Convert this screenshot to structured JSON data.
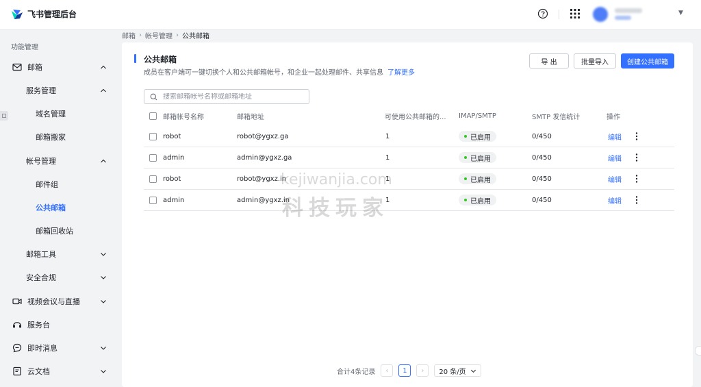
{
  "header": {
    "app_title": "飞书管理后台"
  },
  "sidebar": {
    "section_label": "功能管理",
    "items": [
      {
        "label": "邮箱"
      },
      {
        "label": "服务管理"
      },
      {
        "label": "域名管理"
      },
      {
        "label": "邮箱搬家"
      },
      {
        "label": "帐号管理"
      },
      {
        "label": "邮件组"
      },
      {
        "label": "公共邮箱"
      },
      {
        "label": "邮箱回收站"
      },
      {
        "label": "邮箱工具"
      },
      {
        "label": "安全合规"
      },
      {
        "label": "视频会议与直播"
      },
      {
        "label": "服务台"
      },
      {
        "label": "即时消息"
      },
      {
        "label": "云文档"
      }
    ]
  },
  "breadcrumb": {
    "items": [
      "邮箱",
      "帐号管理",
      "公共邮箱"
    ]
  },
  "page": {
    "title": "公共邮箱",
    "description": "成员在客户端可一键切换个人和公共邮箱帐号，和企业一起处理邮件、共享信息",
    "learn_more": "了解更多",
    "buttons": {
      "export": "导 出",
      "batch_import": "批量导入",
      "create": "创建公共邮箱"
    }
  },
  "search": {
    "placeholder": "搜索邮箱帐号名称或邮箱地址"
  },
  "table": {
    "columns": [
      "邮箱帐号名称",
      "邮箱地址",
      "可使用公共邮箱的...",
      "IMAP/SMTP",
      "SMTP 发信统计",
      "操作"
    ],
    "rows": [
      {
        "name": "robot",
        "address": "robot@ygxz.ga",
        "members": "1",
        "imap": "已启用",
        "smtp_stats": "0/450",
        "action": "编辑"
      },
      {
        "name": "admin",
        "address": "admin@ygxz.ga",
        "members": "1",
        "imap": "已启用",
        "smtp_stats": "0/450",
        "action": "编辑"
      },
      {
        "name": "robot",
        "address": "robot@ygxz.in",
        "members": "1",
        "imap": "已启用",
        "smtp_stats": "0/450",
        "action": "编辑"
      },
      {
        "name": "admin",
        "address": "admin@ygxz.in",
        "members": "1",
        "imap": "已启用",
        "smtp_stats": "0/450",
        "action": "编辑"
      }
    ]
  },
  "pagination": {
    "total": "合计4条记录",
    "current_page": "1",
    "page_size": "20 条/页"
  },
  "watermark": {
    "line1": "kejiwanjia.com",
    "line2": "科技玩家"
  },
  "colors": {
    "accent": "#3370ff",
    "status_enabled": "#34c724"
  }
}
